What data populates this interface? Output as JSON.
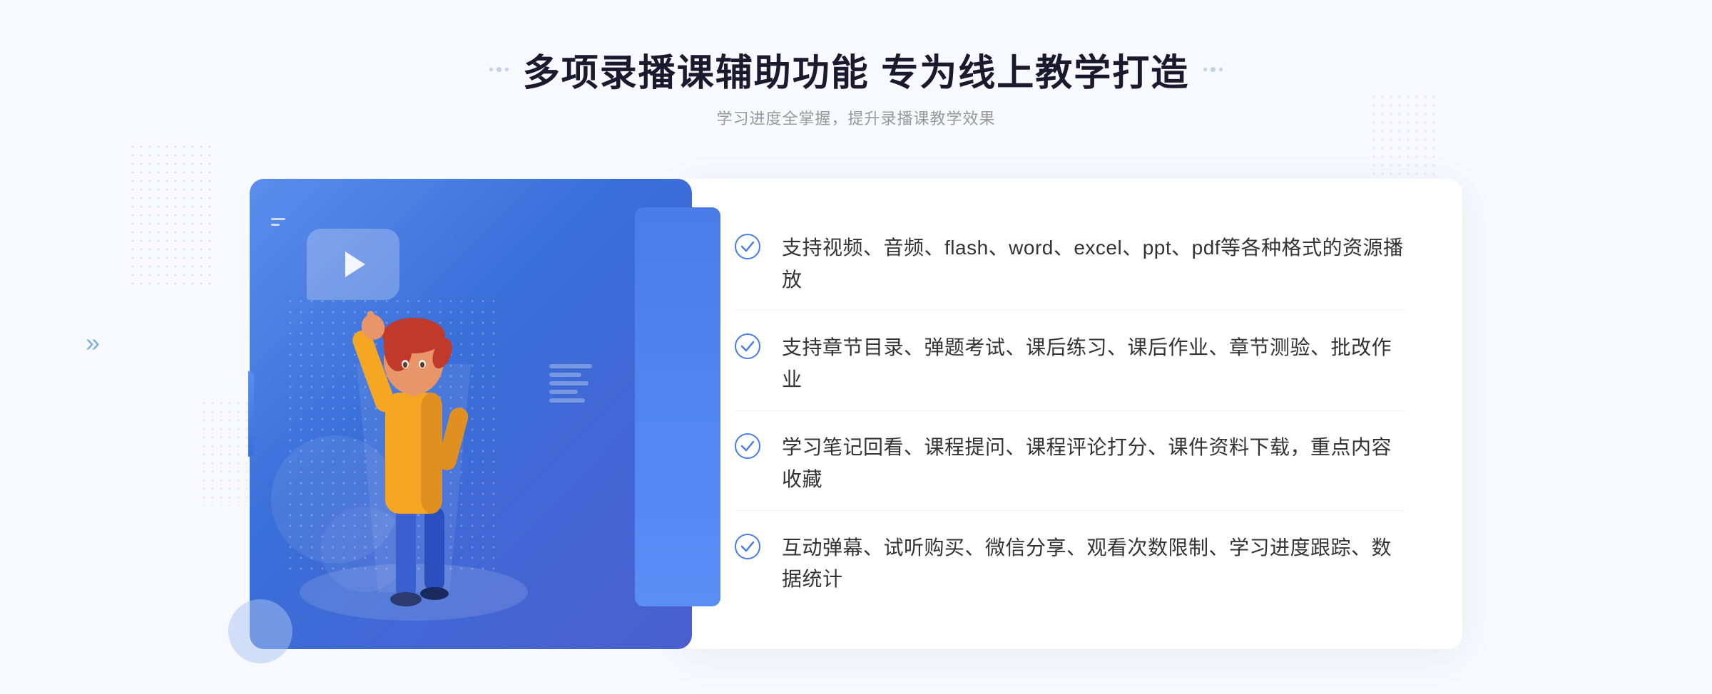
{
  "page": {
    "title": "多项录播课辅助功能 专为线上教学打造",
    "subtitle": "学习进度全掌握，提升录播课教学效果",
    "left_arrow": "»",
    "features": [
      {
        "id": 1,
        "text": "支持视频、音频、flash、word、excel、ppt、pdf等各种格式的资源播放"
      },
      {
        "id": 2,
        "text": "支持章节目录、弹题考试、课后练习、课后作业、章节测验、批改作业"
      },
      {
        "id": 3,
        "text": "学习笔记回看、课程提问、课程评论打分、课件资料下载，重点内容收藏"
      },
      {
        "id": 4,
        "text": "互动弹幕、试听购买、微信分享、观看次数限制、学习进度跟踪、数据统计"
      }
    ],
    "colors": {
      "accent_blue": "#4a7ce8",
      "dark_blue": "#3a6fd8",
      "light_bg": "#f8f9ff",
      "text_dark": "#1a1a2e",
      "text_sub": "#999999"
    }
  }
}
